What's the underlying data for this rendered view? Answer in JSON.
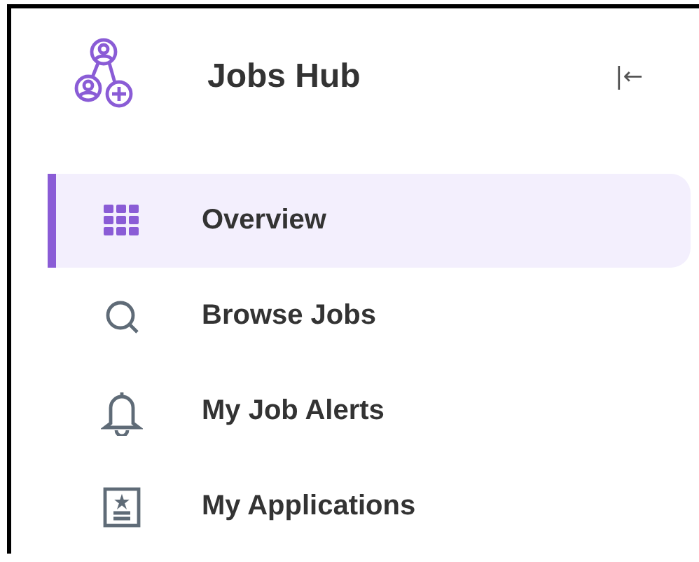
{
  "header": {
    "title": "Jobs Hub",
    "collapse": "|←"
  },
  "nav": [
    {
      "label": "Overview",
      "kind": "grid",
      "selected": true
    },
    {
      "label": "Browse Jobs",
      "kind": "search",
      "selected": false
    },
    {
      "label": "My Job Alerts",
      "kind": "bell",
      "selected": false
    },
    {
      "label": "My Applications",
      "kind": "document",
      "selected": false
    }
  ]
}
